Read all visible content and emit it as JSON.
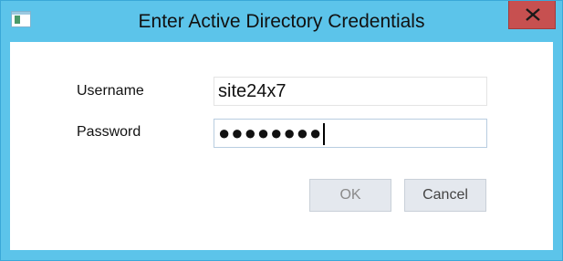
{
  "window": {
    "title": "Enter Active Directory Credentials",
    "icon": "app-window-icon",
    "close_icon": "close-icon",
    "accent_color": "#5cc4ea",
    "close_color": "#c75050"
  },
  "form": {
    "username_label": "Username",
    "username_value": "site24x7",
    "password_label": "Password",
    "password_value": "●●●●●●●●"
  },
  "buttons": {
    "ok_label": "OK",
    "cancel_label": "Cancel"
  }
}
